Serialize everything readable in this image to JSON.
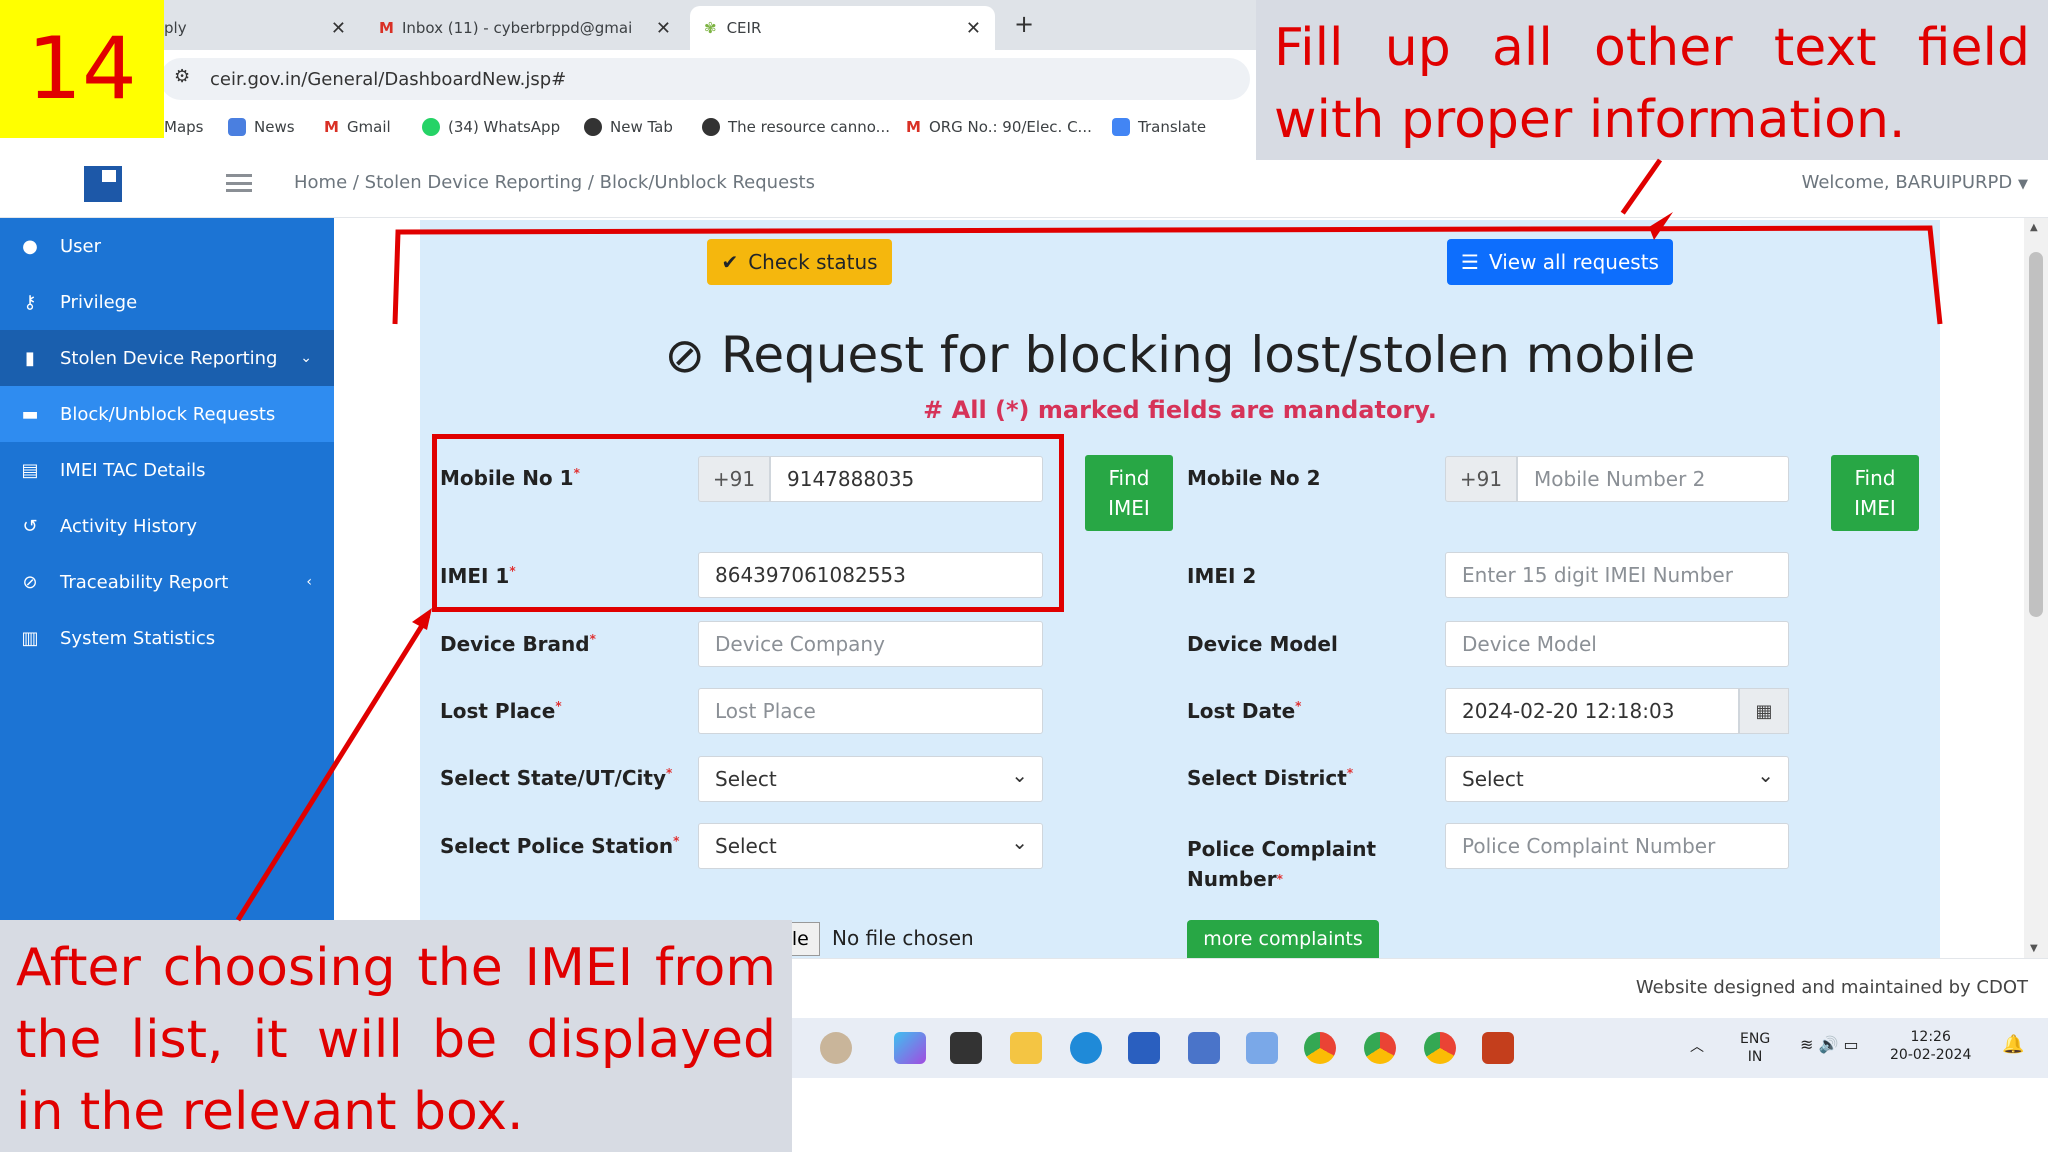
{
  "slide": {
    "number": "14",
    "caption_top": "Fill up all other text field with proper information.",
    "caption_bottom": "After choosing the IMEI from the list, it will be displayed in the relevant box."
  },
  "browser": {
    "tabs": [
      {
        "label": "ply"
      },
      {
        "label": "Inbox (11) - cyberbrppd@gmai"
      },
      {
        "label": "CEIR"
      }
    ],
    "url": "ceir.gov.in/General/DashboardNew.jsp#",
    "bookmarks": [
      "Maps",
      "News",
      "Gmail",
      "(34) WhatsApp",
      "New Tab",
      "The resource canno...",
      "ORG No.: 90/Elec. C...",
      "Translate"
    ]
  },
  "header": {
    "breadcrumb": "Home / Stolen Device Reporting / Block/Unblock Requests",
    "welcome": "Welcome, BARUIPURPD"
  },
  "sidebar": {
    "items": [
      {
        "label": "User",
        "icon": "user-icon"
      },
      {
        "label": "Privilege",
        "icon": "key-icon"
      },
      {
        "label": "Stolen Device Reporting",
        "icon": "phone-icon"
      },
      {
        "label": "Block/Unblock Requests",
        "icon": "block-icon"
      },
      {
        "label": "IMEI TAC Details",
        "icon": "document-icon"
      },
      {
        "label": "Activity History",
        "icon": "history-icon"
      },
      {
        "label": "Traceability Report",
        "icon": "ban-icon"
      },
      {
        "label": "System Statistics",
        "icon": "chart-icon"
      }
    ]
  },
  "form": {
    "check_status": "Check status",
    "view_all": "View all requests",
    "title": "Request for blocking lost/stolen mobile",
    "mandatory_note": "# All (*) marked fields are mandatory.",
    "mobile1_label": "Mobile No 1",
    "mobile1_prefix": "+91",
    "mobile1_value": "9147888035",
    "find_imei": "Find IMEI",
    "mobile2_label": "Mobile No 2",
    "mobile2_prefix": "+91",
    "mobile2_placeholder": "Mobile Number 2",
    "imei1_label": "IMEI 1",
    "imei1_value": "864397061082553",
    "imei2_label": "IMEI 2",
    "imei2_placeholder": "Enter 15 digit IMEI Number",
    "brand_label": "Device Brand",
    "brand_placeholder": "Device Company",
    "model_label": "Device Model",
    "model_placeholder": "Device Model",
    "lost_place_label": "Lost Place",
    "lost_place_placeholder": "Lost Place",
    "lost_date_label": "Lost Date",
    "lost_date_value": "2024-02-20 12:18:03",
    "state_label": "Select State/UT/City",
    "state_value": "Select",
    "district_label": "Select District",
    "district_value": "Select",
    "police_station_label": "Select Police Station",
    "police_station_value": "Select",
    "complaint_label": "Police Complaint Number",
    "complaint_placeholder": "Police Complaint Number",
    "file_button": "File",
    "file_status": "No file chosen",
    "more_complaints": "more complaints"
  },
  "footer": {
    "text": "Website designed and maintained by CDOT"
  },
  "taskbar": {
    "lang": "ENG",
    "region": "IN",
    "time": "12:26",
    "date": "20-02-2024"
  },
  "colors": {
    "sidebar": "#1c74d4",
    "form_bg": "#d9ecfb",
    "annotation_red": "#e00000",
    "number_bg": "#ffff00"
  }
}
